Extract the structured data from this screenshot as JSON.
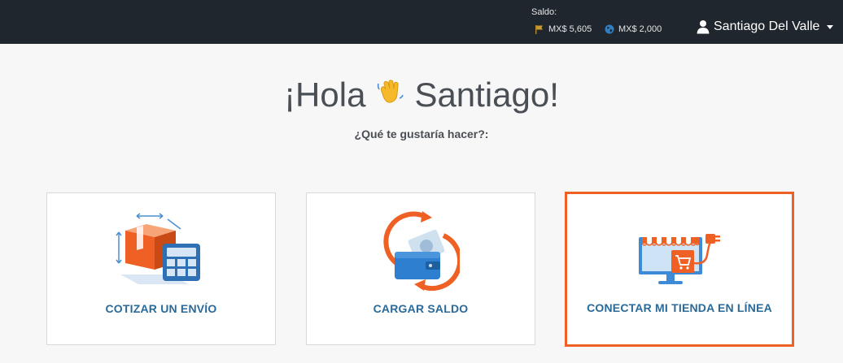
{
  "topbar": {
    "saldo_label": "Saldo:",
    "balance_primary": "MX$ 5,605",
    "balance_secondary": "MX$ 2,000",
    "user_name": "Santiago Del Valle",
    "icons": [
      "flag-icon",
      "globe-icon",
      "user-icon",
      "caret-down-icon"
    ]
  },
  "main": {
    "greeting_start": "¡Hola",
    "greeting_name": "Santiago!",
    "wave_emoji": "👋",
    "subtitle": "¿Qué te gustaría hacer?:"
  },
  "cards": [
    {
      "label": "COTIZAR UN ENVÍO",
      "icon": "box-calculator-icon"
    },
    {
      "label": "CARGAR SALDO",
      "icon": "wallet-refill-icon"
    },
    {
      "label": "CONECTAR MI TIENDA EN LÍNEA",
      "icon": "online-store-icon",
      "highlighted": true
    }
  ],
  "colors": {
    "accent": "#ee6023",
    "link": "#2a6a99",
    "topbar": "#1f262d"
  }
}
